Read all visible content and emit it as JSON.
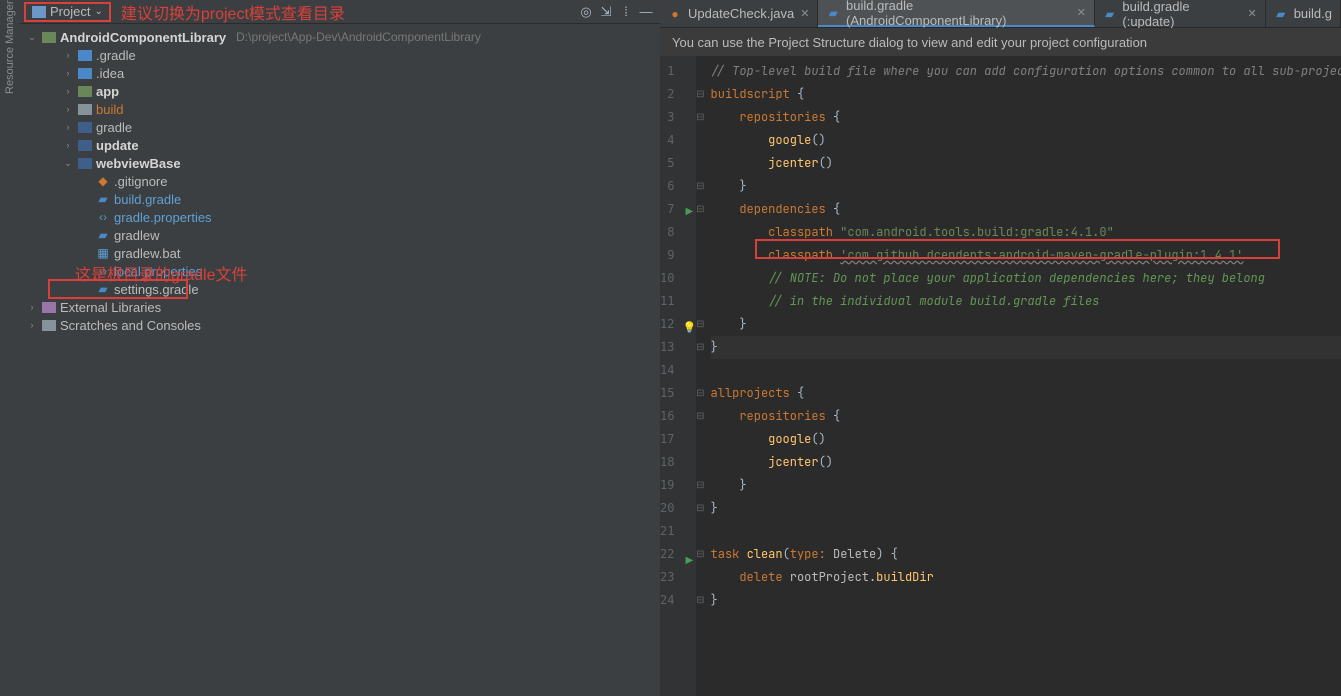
{
  "left_rail_label": "Resource Manager",
  "sidebar_header": {
    "dropdown_label": "Project",
    "icons": {
      "target": "◎",
      "collapse": "⇲",
      "settings": "⁞",
      "hide": "—"
    }
  },
  "annotation_1": "建议切换为project模式查看目录",
  "annotation_2": "这是根目录的gradle文件",
  "project_root": {
    "name": "AndroidComponentLibrary",
    "path": "D:\\project\\App-Dev\\AndroidComponentLibrary"
  },
  "tree": [
    {
      "label": ".gradle",
      "bold": false,
      "cls": "blue",
      "indent": 2,
      "arrow": "›",
      "icon": "folder"
    },
    {
      "label": ".idea",
      "bold": false,
      "cls": "blue",
      "indent": 2,
      "arrow": "›",
      "icon": "folder"
    },
    {
      "label": "app",
      "bold": true,
      "cls": "green",
      "indent": 2,
      "arrow": "›",
      "icon": "folder"
    },
    {
      "label": "build",
      "bold": false,
      "cls": "yellow",
      "indent": 2,
      "arrow": "›",
      "icon": "folder",
      "txtcls": "yellow"
    },
    {
      "label": "gradle",
      "bold": false,
      "cls": "navy",
      "indent": 2,
      "arrow": "›",
      "icon": "folder"
    },
    {
      "label": "update",
      "bold": true,
      "cls": "navy",
      "indent": 2,
      "arrow": "›",
      "icon": "folder"
    },
    {
      "label": "webviewBase",
      "bold": true,
      "cls": "navy",
      "indent": 2,
      "arrow": "⌄",
      "icon": "folder"
    },
    {
      "label": ".gitignore",
      "bold": false,
      "indent": 3,
      "arrow": "",
      "icon": "git"
    },
    {
      "label": "build.gradle",
      "bold": false,
      "indent": 3,
      "arrow": "",
      "icon": "gradle",
      "txtcls": "blue",
      "boxed": true
    },
    {
      "label": "gradle.properties",
      "bold": false,
      "indent": 3,
      "arrow": "",
      "icon": "brackets",
      "txtcls": "blue"
    },
    {
      "label": "gradlew",
      "bold": false,
      "indent": 3,
      "arrow": "",
      "icon": "gradle"
    },
    {
      "label": "gradlew.bat",
      "bold": false,
      "indent": 3,
      "arrow": "",
      "icon": "bat"
    },
    {
      "label": "local.properties",
      "bold": false,
      "indent": 3,
      "arrow": "",
      "icon": "brackets",
      "txtcls": "blue"
    },
    {
      "label": "settings.gradle",
      "bold": false,
      "indent": 3,
      "arrow": "",
      "icon": "gradle"
    }
  ],
  "tree_bottom": [
    {
      "label": "External Libraries",
      "indent": 0,
      "arrow": "›",
      "icon": "purple"
    },
    {
      "label": "Scratches and Consoles",
      "indent": 0,
      "arrow": "›",
      "icon": "gray"
    }
  ],
  "tabs": [
    {
      "label": "UpdateCheck.java",
      "ico": "java",
      "active": false
    },
    {
      "label": "build.gradle (AndroidComponentLibrary)",
      "ico": "grad",
      "active": true
    },
    {
      "label": "build.gradle (:update)",
      "ico": "grad",
      "active": false
    },
    {
      "label": "build.g",
      "ico": "grad",
      "active": false,
      "noclose": true
    }
  ],
  "info_bar": "You can use the Project Structure dialog to view and edit your project configuration",
  "code_lines": [
    {
      "n": 1,
      "mark": "",
      "fold": "",
      "html": "<span class='c-comment'>// Top-level build file where you can add configuration options common to all sub-project</span>"
    },
    {
      "n": 2,
      "mark": "",
      "fold": "⊟",
      "html": "<span class='c-keyword'>buildscript</span> <span class='c-brace'>{</span>"
    },
    {
      "n": 3,
      "mark": "",
      "fold": "⊟",
      "html": "    <span class='c-keyword'>repositories</span> <span class='c-brace'>{</span>"
    },
    {
      "n": 4,
      "mark": "",
      "fold": "",
      "html": "        <span class='c-method'>google</span><span class='c-brace'>()</span>"
    },
    {
      "n": 5,
      "mark": "",
      "fold": "",
      "html": "        <span class='c-method'>jcenter</span><span class='c-brace'>()</span>"
    },
    {
      "n": 6,
      "mark": "",
      "fold": "⊟",
      "html": "    <span class='c-brace'>}</span>"
    },
    {
      "n": 7,
      "mark": "play",
      "fold": "⊟",
      "html": "    <span class='c-keyword'>dependencies</span> <span class='c-brace'>{</span>"
    },
    {
      "n": 8,
      "mark": "",
      "fold": "",
      "html": "        <span class='c-keyword'>classpath</span> <span class='c-string'>\"com.android.tools.build:gradle:4.1.0\"</span>"
    },
    {
      "n": 9,
      "mark": "",
      "fold": "",
      "html": "        <span class='c-keyword'>classpath</span> <span class='c-string c-wavy'>'com.github.dcendents:android-maven-gradle-plugin:1.4.1'</span>"
    },
    {
      "n": 10,
      "mark": "",
      "fold": "",
      "html": "        <span class='c-note'>// NOTE: Do not place your application dependencies here; they belong</span>"
    },
    {
      "n": 11,
      "mark": "",
      "fold": "",
      "html": "        <span class='c-note'>// in the individual module build.gradle files</span>"
    },
    {
      "n": 12,
      "mark": "bulb",
      "fold": "⊟",
      "html": "    <span class='c-brace'>}</span>"
    },
    {
      "n": 13,
      "mark": "",
      "fold": "⊟",
      "html": "<span class='c-brace'>}</span>",
      "hl": true
    },
    {
      "n": 14,
      "mark": "",
      "fold": "",
      "html": " "
    },
    {
      "n": 15,
      "mark": "",
      "fold": "⊟",
      "html": "<span class='c-keyword'>allprojects</span> <span class='c-brace'>{</span>"
    },
    {
      "n": 16,
      "mark": "",
      "fold": "⊟",
      "html": "    <span class='c-keyword'>repositories</span> <span class='c-brace'>{</span>"
    },
    {
      "n": 17,
      "mark": "",
      "fold": "",
      "html": "        <span class='c-method'>google</span><span class='c-brace'>()</span>"
    },
    {
      "n": 18,
      "mark": "",
      "fold": "",
      "html": "        <span class='c-method'>jcenter</span><span class='c-brace'>()</span>"
    },
    {
      "n": 19,
      "mark": "",
      "fold": "⊟",
      "html": "    <span class='c-brace'>}</span>"
    },
    {
      "n": 20,
      "mark": "",
      "fold": "⊟",
      "html": "<span class='c-brace'>}</span>"
    },
    {
      "n": 21,
      "mark": "",
      "fold": "",
      "html": " "
    },
    {
      "n": 22,
      "mark": "play",
      "fold": "⊟",
      "html": "<span class='c-keyword'>task</span> <span class='c-method'>clean</span><span class='c-brace'>(</span><span class='c-keyword'>type:</span> Delete<span class='c-brace'>)</span> <span class='c-brace'>{</span>"
    },
    {
      "n": 23,
      "mark": "",
      "fold": "",
      "html": "    <span class='c-keyword'>delete</span> rootProject.<span class='c-method'>buildDir</span>"
    },
    {
      "n": 24,
      "mark": "",
      "fold": "⊟",
      "html": "<span class='c-brace'>}</span>"
    }
  ]
}
